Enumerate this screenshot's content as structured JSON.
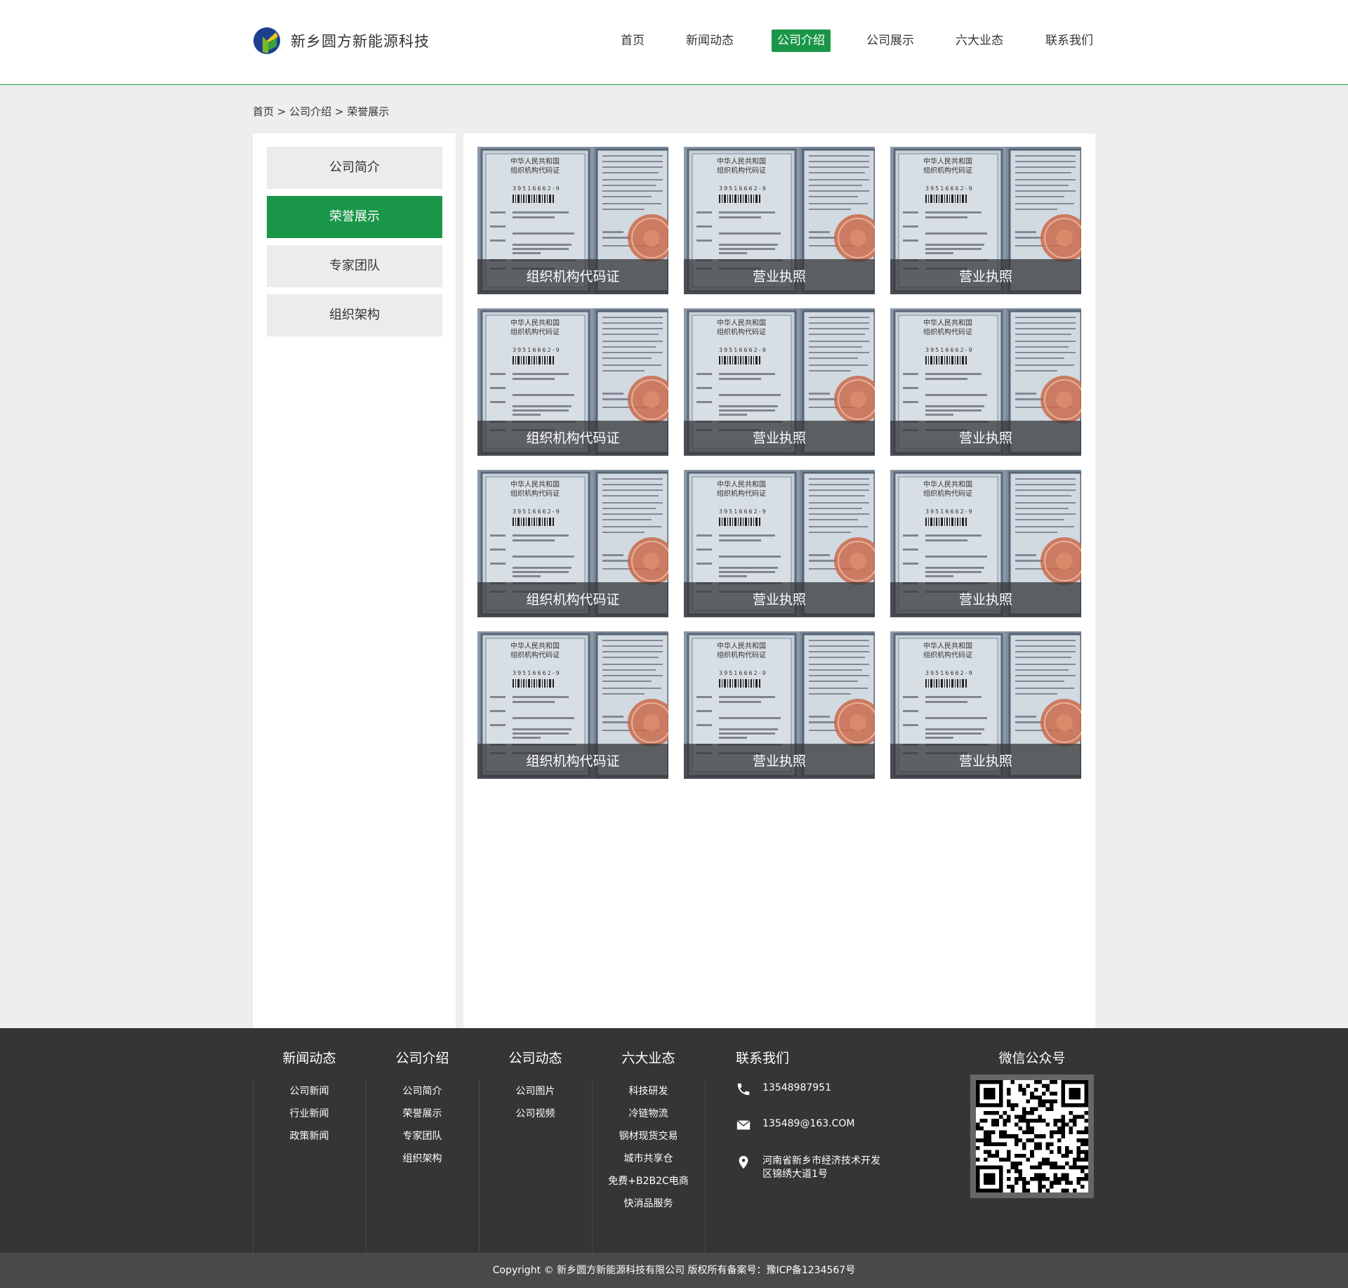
{
  "header": {
    "company_name": "新乡圆方新能源科技",
    "nav": [
      {
        "label": "首页"
      },
      {
        "label": "新闻动态"
      },
      {
        "label": "公司介绍",
        "active": true
      },
      {
        "label": "公司展示"
      },
      {
        "label": "六大业态"
      },
      {
        "label": "联系我们"
      }
    ]
  },
  "breadcrumb": "首页 > 公司介绍 > 荣誉展示",
  "sidebar": {
    "items": [
      {
        "label": "公司简介"
      },
      {
        "label": "荣誉展示",
        "active": true
      },
      {
        "label": "专家团队"
      },
      {
        "label": "组织架构"
      }
    ]
  },
  "honors": [
    {
      "caption": "组织机构代码证"
    },
    {
      "caption": "营业执照"
    },
    {
      "caption": "营业执照"
    },
    {
      "caption": "组织机构代码证"
    },
    {
      "caption": "营业执照"
    },
    {
      "caption": "营业执照"
    },
    {
      "caption": "组织机构代码证"
    },
    {
      "caption": "营业执照"
    },
    {
      "caption": "营业执照"
    },
    {
      "caption": "组织机构代码证"
    },
    {
      "caption": "营业执照"
    },
    {
      "caption": "营业执照"
    }
  ],
  "certificate_text": {
    "line1": "中华人民共和国",
    "line2": "组织机构代码证",
    "code": "39516662-9"
  },
  "footer": {
    "columns": [
      {
        "title": "新闻动态",
        "links": [
          "公司新闻",
          "行业新闻",
          "政策新闻"
        ]
      },
      {
        "title": "公司介绍",
        "links": [
          "公司简介",
          "荣誉展示",
          "专家团队",
          "组织架构"
        ]
      },
      {
        "title": "公司动态",
        "links": [
          "公司图片",
          "公司视频"
        ]
      },
      {
        "title": "六大业态",
        "links": [
          "科技研发",
          "冷链物流",
          "钢材现货交易",
          "城市共享仓",
          "免费+B2B2C电商",
          "快消品服务"
        ]
      }
    ],
    "contact": {
      "title": "联系我们",
      "phone": "13548987951",
      "email": "135489@163.COM",
      "address": "河南省新乡市经济技术开发区锦绣大道1号"
    },
    "wechat_title": "微信公众号",
    "copyright": "Copyright ©    新乡圆方新能源科技有限公司 版权所有备案号：豫ICP备1234567号"
  },
  "colors": {
    "brand_green": "#1a9648",
    "footer_bg": "#353535",
    "copyright_bg": "#4a4a4a",
    "page_bg": "#eeeeee"
  },
  "icons": {
    "logo": "logo-icon",
    "phone": "phone-icon",
    "email": "email-icon",
    "address": "location-pin-icon",
    "qr": "qr-code"
  }
}
